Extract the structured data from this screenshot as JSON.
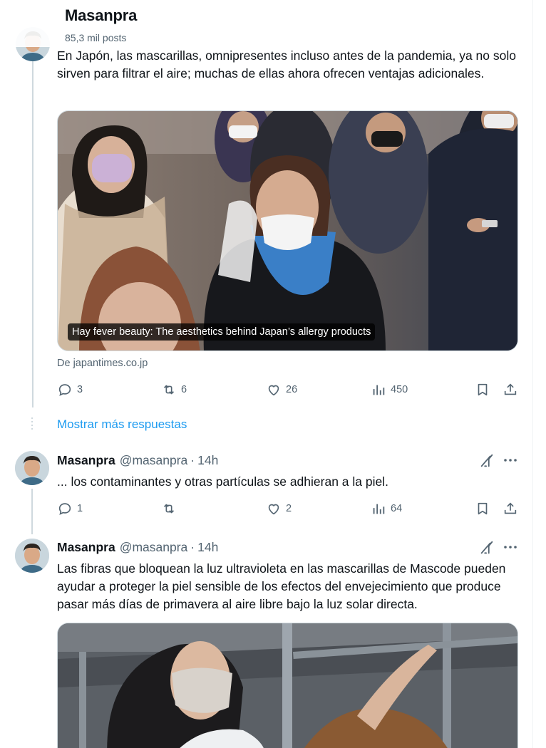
{
  "header": {
    "title": "Masanpra",
    "subtitle": "85,3 mil posts"
  },
  "post1": {
    "text": "En Japón, las mascarillas, omnipresentes incluso antes de la pandemia, ya no solo sirven para filtrar el aire; muchas de ellas ahora ofrecen ventajas adicionales.",
    "card_caption": "Hay fever beauty: The aesthetics behind Japan’s allergy products",
    "source": "De japantimes.co.jp",
    "replies": "3",
    "reposts": "6",
    "likes": "26",
    "views": "450"
  },
  "show_more": "Mostrar más respuestas",
  "post2": {
    "name": "Masanpra",
    "handle": "@masanpra",
    "separator": "·",
    "time": "14h",
    "text": "... los contaminantes y otras partículas se adhieran a la piel.",
    "replies": "1",
    "reposts": "",
    "likes": "2",
    "views": "64"
  },
  "post3": {
    "name": "Masanpra",
    "handle": "@masanpra",
    "separator": "·",
    "time": "14h",
    "text": "Las fibras que bloquean la luz ultravioleta en las mascarillas de Mascode pueden ayudar a proteger la piel sensible de los efectos del envejecimiento que produce pasar más días de primavera al aire libre bajo la luz solar directa."
  },
  "colors": {
    "accent": "#1d9bf0",
    "secondary_text": "#536471",
    "primary_text": "#0f1419"
  },
  "icons": [
    "reply-icon",
    "repost-icon",
    "like-icon",
    "views-icon",
    "bookmark-icon",
    "share-icon",
    "grok-icon",
    "more-icon"
  ]
}
